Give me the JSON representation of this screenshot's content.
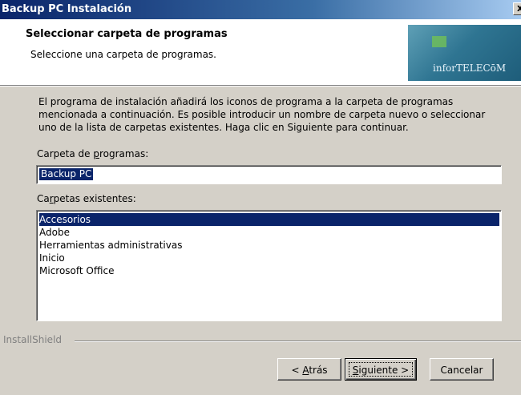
{
  "window": {
    "title": "Backup PC Instalación",
    "close_glyph": "x"
  },
  "header": {
    "title": "Seleccionar carpeta de programas",
    "subtitle": "Seleccione una carpeta de programas.",
    "logo_text": "inforTELECōM"
  },
  "description": {
    "line1": "El programa de instalación añadirá los iconos de programa a la carpeta de programas",
    "line2": "mencionada a continuación.  Es posible introducir un nombre de carpeta nuevo o seleccionar",
    "line3": "uno de la lista de carpetas existentes.  Haga clic en Siguiente para continuar."
  },
  "program_folder": {
    "label_pre": "Carpeta de ",
    "label_mnemonic": "p",
    "label_post": "rogramas:",
    "value": "Backup PC"
  },
  "existing_folders": {
    "label_pre": "Ca",
    "label_mnemonic": "r",
    "label_post": "petas existentes:",
    "items": [
      "Accesorios",
      "Adobe",
      "Herramientas administrativas",
      "Inicio",
      "Microsoft Office"
    ],
    "selected_index": 0
  },
  "footer": {
    "brand": "InstallShield"
  },
  "buttons": {
    "back": {
      "prefix": "< ",
      "mnemonic": "A",
      "rest": "trás"
    },
    "next": {
      "mnemonic": "S",
      "rest": "iguiente >"
    },
    "cancel": {
      "label": "Cancelar"
    }
  }
}
